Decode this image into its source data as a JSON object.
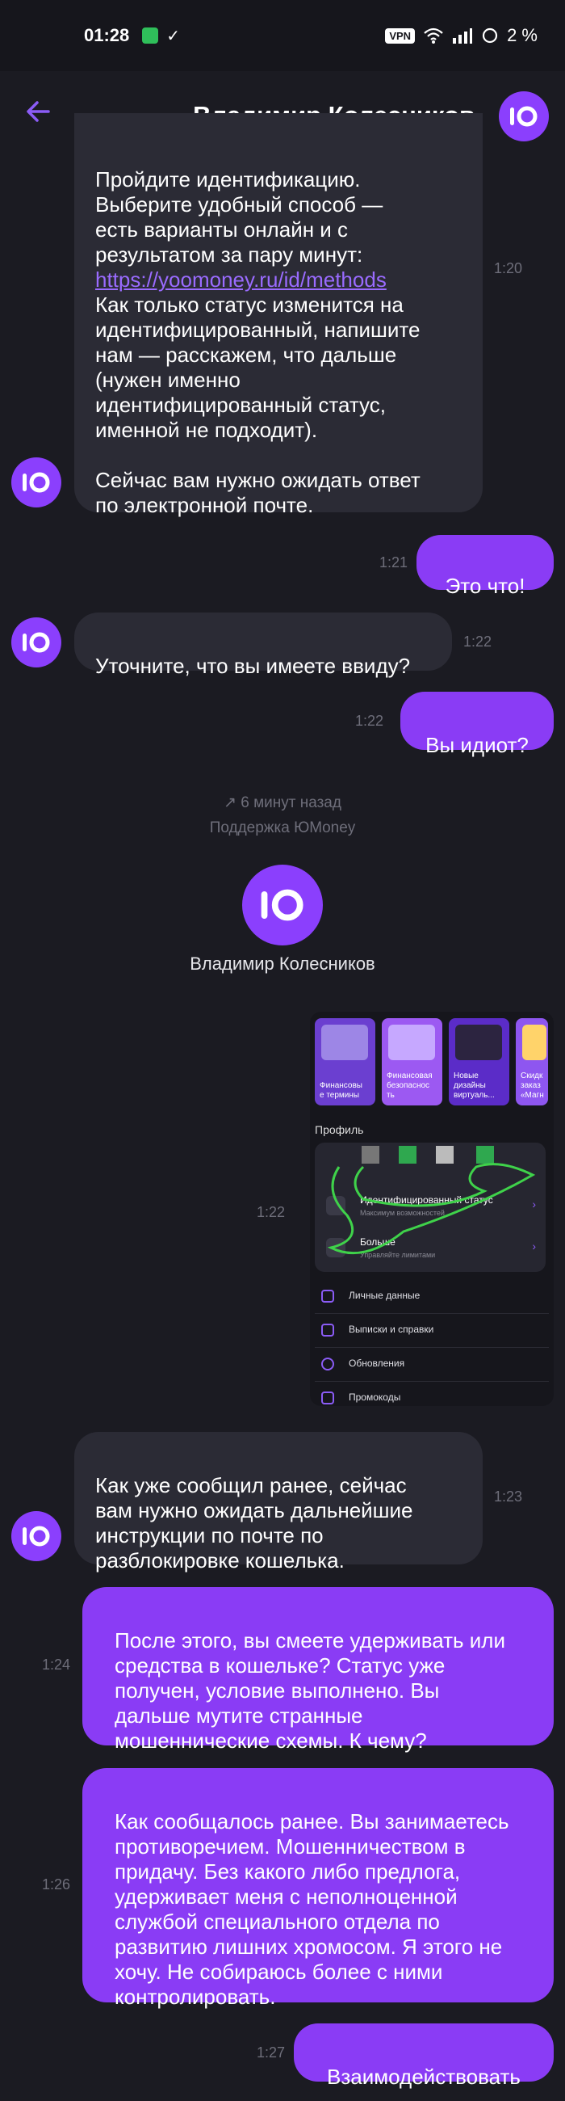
{
  "status_bar": {
    "time": "01:28",
    "vpn_label": "VPN",
    "battery": "2 %"
  },
  "header": {
    "title": "Владимир Колесников"
  },
  "messages": {
    "m1": {
      "text_before_link": "Пройдите идентификацию.\nВыберите удобный способ —\nесть варианты онлайн и с\nрезультатом за пару минут:",
      "link": "https://yoomoney.ru/id/methods",
      "text_after_link": "Как только статус изменится на\nидентифицированный, напишите\nнам — расскажем, что дальше\n(нужен именно\nидентифицированный статус,\nименной не подходит).\n\nСейчас вам нужно ожидать ответ\nпо электронной почте.",
      "time": "1:20"
    },
    "m2": {
      "text": "Это что!",
      "time": "1:21"
    },
    "m3": {
      "text": "Уточните, что вы имеете ввиду?",
      "time": "1:22"
    },
    "m4": {
      "text": "Вы идиот?",
      "time": "1:22"
    },
    "m5": {
      "time": "1:22"
    },
    "m6": {
      "text": "Как уже сообщил ранее, сейчас\nвам нужно ожидать дальнейшие\nинструкции по почте по\nразблокировке кошелька.",
      "time": "1:23"
    },
    "m7": {
      "text": "После этого, вы смеете удерживать или\nсредства в кошельке? Статус уже\nполучен, условие выполнено. Вы\nдальше мутите странные\nмошеннические схемы. К чему?",
      "time": "1:24"
    },
    "m8": {
      "text": "Как сообщалось ранее. Вы занимаетесь\nпротиворечием.  Мошенничеством в\nпридачу. Без какого либо предлога,\nудерживает меня с неполноценной\nслужбой специального отдела по\nразвитию лишних хромосом. Я этого не\nхочу. Не собираюсь более с ними\nконтролировать.",
      "time": "1:26"
    },
    "m9": {
      "text": "Взаимодействовать",
      "time": "1:27"
    }
  },
  "system": {
    "transfer_time": "6 минут назад",
    "transfer_source": "Поддержка ЮMoney",
    "agent_name": "Владимир Колесников"
  },
  "screenshot": {
    "cards": [
      "Финансовы\nе термины",
      "Финансовая\nбезопаснос\nть",
      "Новые\nдизайны\nвиртуаль...",
      "Скидк\nзаказ\n«Магн"
    ],
    "profile_title": "Профиль",
    "row1_title": "Идентифицированный статус",
    "row1_sub": "Максимум возможностей",
    "row2_title": "Больше",
    "row2_sub": "Управляйте лимитами",
    "menu": [
      "Личные данные",
      "Выписки и справки",
      "Обновления",
      "Промокоды"
    ]
  },
  "colors": {
    "accent": "#8a3cf5",
    "incoming_bubble": "#2b2b35",
    "background": "#1b1b22"
  }
}
